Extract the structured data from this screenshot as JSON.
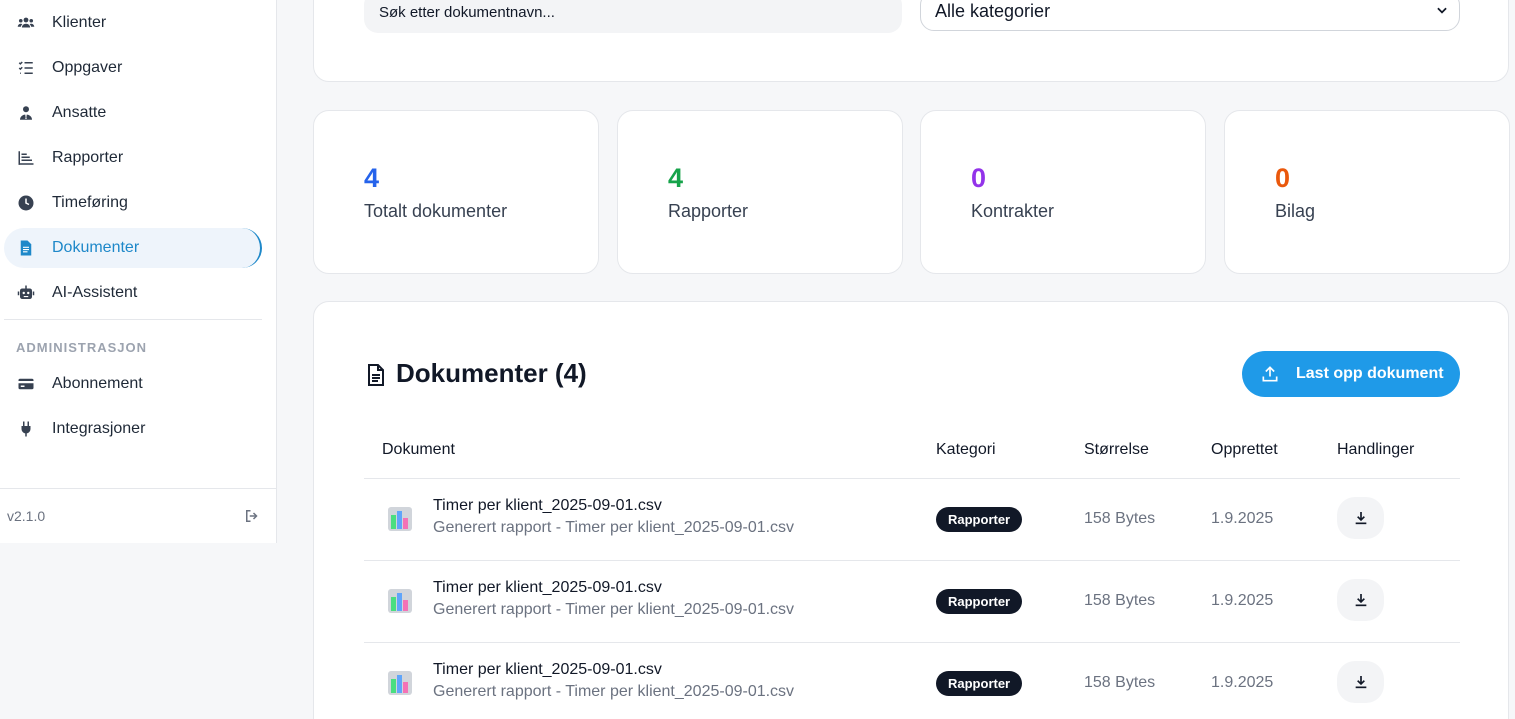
{
  "sidebar": {
    "items": [
      {
        "label": "Klienter",
        "icon": "users-icon"
      },
      {
        "label": "Oppgaver",
        "icon": "checklist-icon"
      },
      {
        "label": "Ansatte",
        "icon": "user-tie-icon"
      },
      {
        "label": "Rapporter",
        "icon": "chart-bar-icon"
      },
      {
        "label": "Timeføring",
        "icon": "clock-icon"
      },
      {
        "label": "Dokumenter",
        "icon": "file-icon",
        "active": true
      },
      {
        "label": "AI-Assistent",
        "icon": "robot-icon"
      }
    ],
    "section_label": "ADMINISTRASJON",
    "admin_items": [
      {
        "label": "Abonnement",
        "icon": "credit-card-icon"
      },
      {
        "label": "Integrasjoner",
        "icon": "plug-icon"
      }
    ],
    "version": "v2.1.0"
  },
  "filters": {
    "search_placeholder": "Søk etter dokumentnavn...",
    "category_selected": "Alle kategorier"
  },
  "stats": [
    {
      "value": "4",
      "label": "Totalt dokumenter",
      "color": "#2563eb"
    },
    {
      "value": "4",
      "label": "Rapporter",
      "color": "#16a34a"
    },
    {
      "value": "0",
      "label": "Kontrakter",
      "color": "#9333ea"
    },
    {
      "value": "0",
      "label": "Bilag",
      "color": "#ea580c"
    }
  ],
  "documents": {
    "title": "Dokumenter (4)",
    "upload_label": "Last opp dokument",
    "columns": [
      "Dokument",
      "Kategori",
      "Størrelse",
      "Opprettet",
      "Handlinger"
    ],
    "rows": [
      {
        "name": "Timer per klient_2025-09-01.csv",
        "description": "Generert rapport - Timer per klient_2025-09-01.csv",
        "category": "Rapporter",
        "size": "158 Bytes",
        "created": "1.9.2025"
      },
      {
        "name": "Timer per klient_2025-09-01.csv",
        "description": "Generert rapport - Timer per klient_2025-09-01.csv",
        "category": "Rapporter",
        "size": "158 Bytes",
        "created": "1.9.2025"
      },
      {
        "name": "Timer per klient_2025-09-01.csv",
        "description": "Generert rapport - Timer per klient_2025-09-01.csv",
        "category": "Rapporter",
        "size": "158 Bytes",
        "created": "1.9.2025"
      }
    ]
  },
  "colors": {
    "accent": "#1f9ae8",
    "active_nav": "#1e88c9"
  }
}
